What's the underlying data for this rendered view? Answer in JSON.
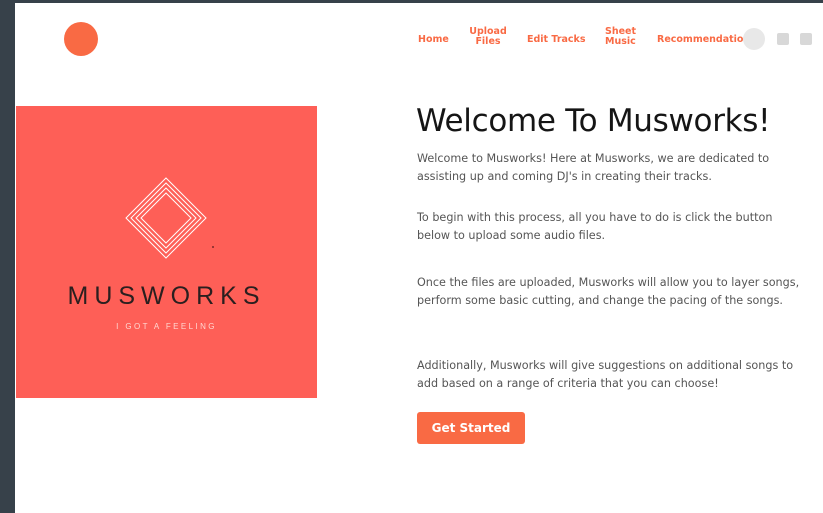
{
  "nav": {
    "items": [
      {
        "label": "Home"
      },
      {
        "label": "Upload Files"
      },
      {
        "label": "Edit Tracks"
      },
      {
        "label": "Sheet Music"
      },
      {
        "label": "Recommendations"
      }
    ]
  },
  "hero": {
    "brand": "MUSWORKS",
    "tagline": "I GOT A FEELING"
  },
  "main": {
    "title": "Welcome To Musworks!",
    "paragraphs": [
      "Welcome to Musworks! Here at Musworks, we are dedicated to assisting up and coming DJ's in creating their tracks.",
      "To begin with this process, all you have to do is click the button below to upload some audio files.",
      "Once the files are uploaded, Musworks will allow you to layer songs, perform some basic cutting, and change the pacing of the songs.",
      "Additionally, Musworks will give suggestions on additional songs to add based on a range of criteria that you can choose!"
    ],
    "cta_label": "Get Started"
  },
  "colors": {
    "accent": "#f96a44",
    "hero_bg": "#fe5f57",
    "outer_bg": "#37414a"
  },
  "icons": {
    "logo": "circle-logo-icon",
    "avatar": "avatar-icon",
    "hero_mark": "diamond-icon"
  }
}
